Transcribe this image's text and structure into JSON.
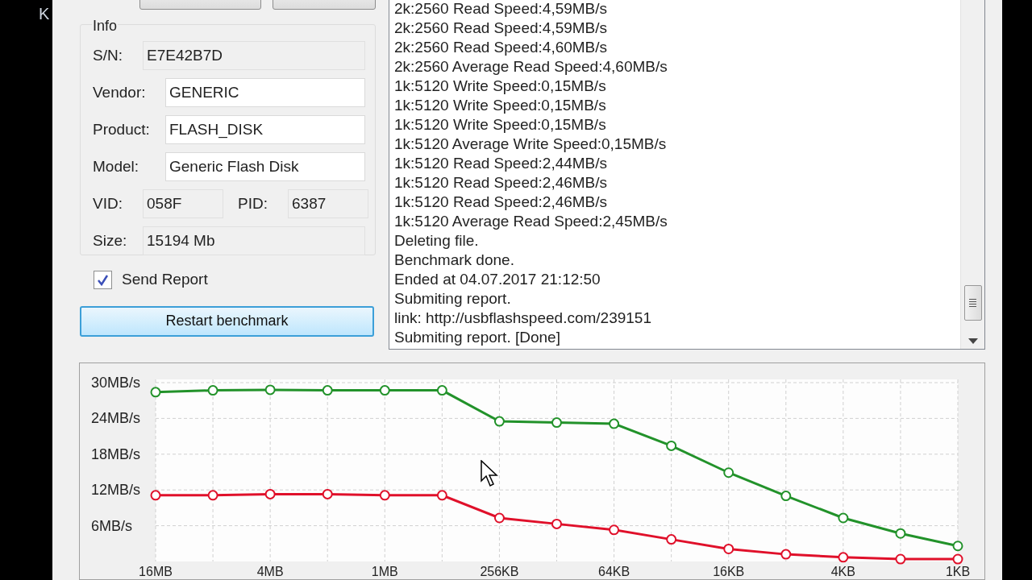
{
  "desktop": {
    "label": "K"
  },
  "info": {
    "title": "Info",
    "rows": [
      {
        "fields": [
          {
            "label": "S/N:",
            "value": "E7E42B7D",
            "readonly": true
          }
        ]
      },
      {
        "fields": [
          {
            "label": "Vendor:",
            "value": "GENERIC",
            "readonly": false
          }
        ]
      },
      {
        "fields": [
          {
            "label": "Product:",
            "value": "FLASH_DISK",
            "readonly": false
          }
        ]
      },
      {
        "fields": [
          {
            "label": "Model:",
            "value": "Generic Flash Disk",
            "readonly": false
          }
        ]
      },
      {
        "fields": [
          {
            "label": "VID:",
            "value": "058F",
            "readonly": true
          },
          {
            "label": "PID:",
            "value": "6387",
            "readonly": true
          }
        ]
      },
      {
        "fields": [
          {
            "label": "Size:",
            "value": "15194 Mb",
            "readonly": true
          }
        ]
      }
    ]
  },
  "send_report": {
    "label": "Send Report",
    "checked": true
  },
  "restart_button": {
    "label": "Restart benchmark"
  },
  "log": [
    "2k:2560 Read Speed:4,59MB/s",
    "2k:2560 Read Speed:4,59MB/s",
    "2k:2560 Read Speed:4,60MB/s",
    "2k:2560 Average Read Speed:4,60MB/s",
    "1k:5120 Write Speed:0,15MB/s",
    "1k:5120 Write Speed:0,15MB/s",
    "1k:5120 Write Speed:0,15MB/s",
    "1k:5120 Average Write Speed:0,15MB/s",
    "1k:5120 Read Speed:2,44MB/s",
    "1k:5120 Read Speed:2,46MB/s",
    "1k:5120 Read Speed:2,46MB/s",
    "1k:5120 Average Read Speed:2,45MB/s",
    "Deleting file.",
    "Benchmark done.",
    "Ended at 04.07.2017 21:12:50",
    "Submiting report.",
    "link: http://usbflashspeed.com/239151",
    "Submiting report. [Done]"
  ],
  "chart": {
    "chart_data": {
      "type": "line",
      "categories": [
        "16MB",
        null,
        "4MB",
        null,
        "1MB",
        null,
        "256KB",
        null,
        "64KB",
        null,
        "16KB",
        null,
        "4KB",
        null,
        "1KB"
      ],
      "series": [
        {
          "color": "#22922a",
          "marker": "circle",
          "values": [
            28.4,
            28.7,
            28.8,
            28.7,
            28.7,
            28.7,
            23.5,
            23.3,
            23.1,
            19.4,
            14.9,
            11.0,
            7.3,
            4.7,
            2.6
          ]
        },
        {
          "color": "#e0102a",
          "marker": "circle",
          "values": [
            11.1,
            11.1,
            11.3,
            11.3,
            11.1,
            11.1,
            7.3,
            6.3,
            5.3,
            3.7,
            2.1,
            1.2,
            0.7,
            0.4,
            0.4
          ]
        }
      ],
      "ylim": [
        0,
        30
      ],
      "grid": true,
      "yticks": [
        {
          "value": 6,
          "label": "6MB/s"
        },
        {
          "value": 12,
          "label": "12MB/s"
        },
        {
          "value": 18,
          "label": "18MB/s"
        },
        {
          "value": 24,
          "label": "24MB/s"
        },
        {
          "value": 30,
          "label": "30MB/s"
        }
      ]
    }
  }
}
